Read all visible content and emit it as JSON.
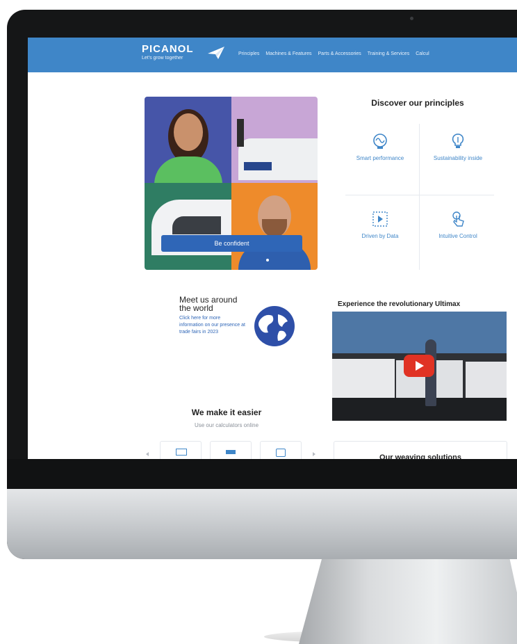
{
  "brand": {
    "name": "PICANOL",
    "tagline": "Let's grow together"
  },
  "nav": {
    "links": [
      "Principles",
      "Machines & Features",
      "Parts & Accessories",
      "Training & Services",
      "Calcul"
    ]
  },
  "hero": {
    "button_label": "Be confident"
  },
  "principles": {
    "title": "Discover our principles",
    "items": [
      {
        "label": "Smart performance",
        "icon": "brain-icon"
      },
      {
        "label": "Sustainability inside",
        "icon": "bulb-icon"
      },
      {
        "label": "Driven by Data",
        "icon": "data-icon"
      },
      {
        "label": "Intuitive Control",
        "icon": "touch-icon"
      }
    ]
  },
  "meet": {
    "title": "Meet us around the world",
    "text": "Click here for more information on our presence at trade fairs in 2023"
  },
  "experience": {
    "title": "Experience the revolutionary Ultimax"
  },
  "easier": {
    "title": "We make it easier",
    "subtitle": "Use our calculators online"
  },
  "weaving": {
    "title": "Our weaving solutions"
  },
  "colors": {
    "nav_blue": "#3f86c8",
    "accent_blue": "#2f66b7",
    "play_red": "#e03224"
  }
}
